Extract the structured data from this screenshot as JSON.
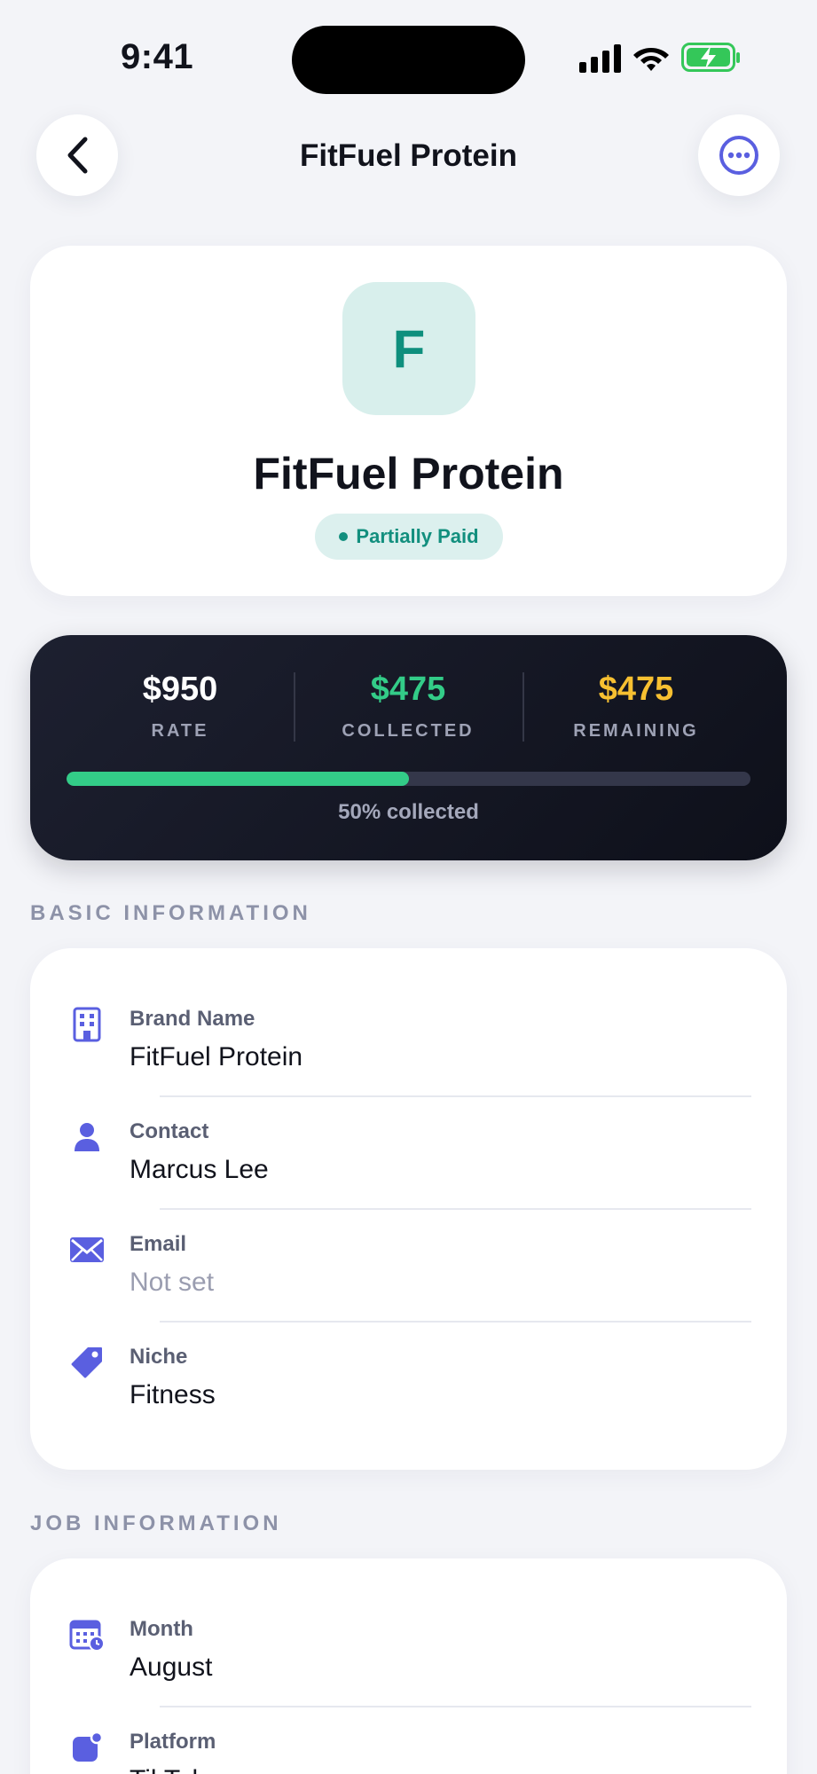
{
  "status_bar": {
    "time": "9:41"
  },
  "nav": {
    "title": "FitFuel Protein"
  },
  "brand": {
    "initial": "F",
    "name": "FitFuel Protein",
    "status": "Partially Paid"
  },
  "stats": {
    "rate_value": "$950",
    "rate_label": "RATE",
    "collected_value": "$475",
    "collected_label": "COLLECTED",
    "remaining_value": "$475",
    "remaining_label": "REMAINING",
    "progress_percent": 50,
    "progress_text": "50% collected"
  },
  "basic_info": {
    "title": "BASIC INFORMATION",
    "rows": [
      {
        "label": "Brand Name",
        "value": "FitFuel Protein",
        "icon": "building-icon"
      },
      {
        "label": "Contact",
        "value": "Marcus Lee",
        "icon": "person-icon"
      },
      {
        "label": "Email",
        "value": "Not set",
        "icon": "envelope-icon"
      },
      {
        "label": "Niche",
        "value": "Fitness",
        "icon": "tag-icon"
      }
    ]
  },
  "job_info": {
    "title": "JOB INFORMATION",
    "rows": [
      {
        "label": "Month",
        "value": "August",
        "icon": "calendar-icon"
      },
      {
        "label": "Platform",
        "value": "TikTok",
        "icon": "app-badge-icon"
      }
    ]
  },
  "colors": {
    "accent": "#5a5fe0",
    "success": "#33cc88",
    "warning": "#f7c031",
    "teal": "#128f7e"
  }
}
